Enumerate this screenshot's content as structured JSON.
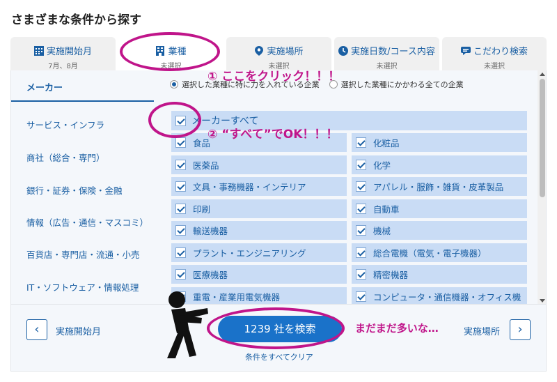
{
  "page": {
    "title": "さまざまな条件から探す"
  },
  "tabs": [
    {
      "label": "実施開始月",
      "sub": "7月、8月",
      "icon": "calendar-grid-icon"
    },
    {
      "label": "業種",
      "sub": "未選択",
      "icon": "building-icon"
    },
    {
      "label": "実施場所",
      "sub": "未選択",
      "icon": "map-pin-icon"
    },
    {
      "label": "実施日数/コース内容",
      "sub": "未選択",
      "icon": "clock-icon"
    },
    {
      "label": "こだわり検索",
      "sub": "未選択",
      "icon": "chat-bubble-icon"
    }
  ],
  "categories": {
    "active": "メーカー",
    "items": [
      "サービス・インフラ",
      "商社（総合・専門）",
      "銀行・証券・保険・金融",
      "情報（広告・通信・マスコミ）",
      "百貨店・専門店・流通・小売",
      "IT・ソフトウェア・情報処理"
    ]
  },
  "filter": {
    "option1": "選択した業種に特に力を入れている企業",
    "option2": "選択した業種にかかわる全ての企業",
    "selected": "option1"
  },
  "select_all": {
    "label": "メーカーすべて",
    "checked": true
  },
  "industries": [
    "食品",
    "化粧品",
    "医薬品",
    "化学",
    "文具・事務機器・インテリア",
    "アパレル・服飾・雑貨・皮革製品",
    "印刷",
    "自動車",
    "輸送機器",
    "機械",
    "プラント・エンジニアリング",
    "総合電機（電気・電子機器）",
    "医療機器",
    "精密機器",
    "重電・産業用電気機器",
    "コンピュータ・通信機器・オフィス機"
  ],
  "footer": {
    "prev_label": "実施開始月",
    "next_label": "実施場所",
    "search_button": "1239 社を検索",
    "clear_link": "条件をすべてクリア"
  },
  "annotations": {
    "step1": "① ここをクリック！！！",
    "step2": "② “すべて”でOK！！！",
    "comment": "まだまだ多いな…"
  },
  "colors": {
    "accent": "#1a5fa3",
    "button": "#1a72c9",
    "item_bg": "#c9dcf5",
    "annotation": "#c0158a"
  }
}
